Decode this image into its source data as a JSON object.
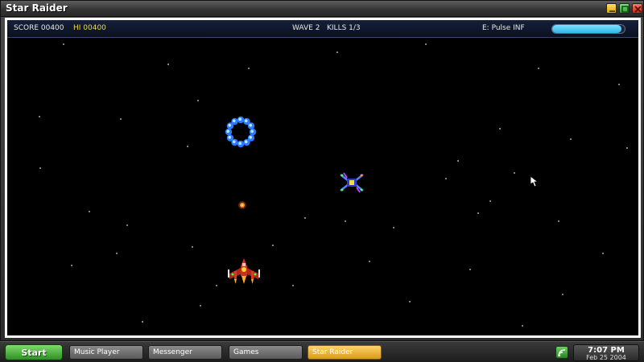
{
  "window": {
    "title": "Star Raider"
  },
  "hud": {
    "score": "SCORE 00400",
    "hi_score": "HI 00400",
    "wave_kills": "WAVE 2   KILLS 1/3",
    "weapon": "E: Pulse INF",
    "energy_fraction": 0.95,
    "colors": {
      "hi_score": "#f0d84a",
      "energy": "#3cc4f0"
    }
  },
  "scene": {
    "player_ship": "red-fighter-ship",
    "enemy": "blue-alien-ship",
    "enemy_shot": "orange-plasma-bullet",
    "powerup": "blue-orb-ring",
    "cursor": "hand-pointer"
  },
  "taskbar": {
    "start_label": "Start",
    "tasks": [
      {
        "label": "Music Player",
        "active": false
      },
      {
        "label": "Messenger",
        "active": false
      },
      {
        "label": "Games",
        "active": false
      },
      {
        "label": "Star Raider",
        "active": true
      }
    ],
    "tray_icon": "network-icon",
    "clock": {
      "time": "7:07 PM",
      "date": "Feb 25 2004"
    }
  }
}
